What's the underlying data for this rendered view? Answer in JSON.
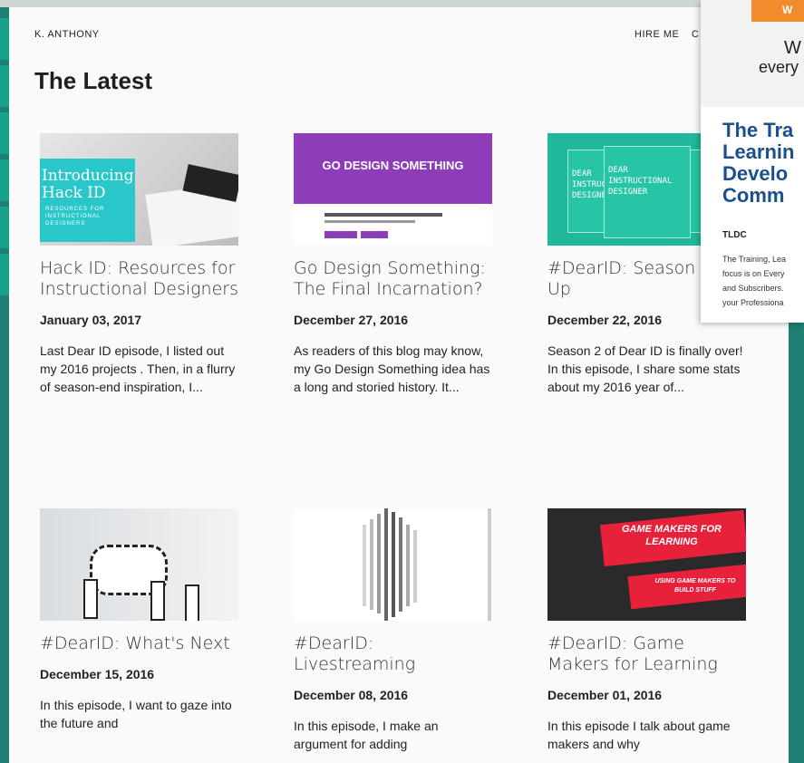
{
  "site": {
    "brand": "K. ANTHONY",
    "nav": [
      "HIRE ME",
      "C"
    ]
  },
  "section_title": "The Latest",
  "posts": [
    {
      "title": "Hack ID: Resources for Instructional Designers",
      "date": "January 03, 2017",
      "excerpt": "Last Dear ID episode, I listed out my 2016 projects . Then, in a flurry of season-end inspiration, I...",
      "thumb": {
        "big": "Introducing Hack ID",
        "small": "RESOURCES FOR INSTRUCTIONAL DESIGNERS"
      }
    },
    {
      "title": "Go Design Something: The Final Incarnation?",
      "date": "December 27, 2016",
      "excerpt": "As readers of this blog may know, my Go Design Something idea has a long and storied history. It...",
      "thumb": {
        "headline": "GO DESIGN SOMETHING",
        "accent": "#8e3db8"
      }
    },
    {
      "title": "#DearID: Season Wrap Up",
      "date": "December 22, 2016",
      "excerpt": "Season 2 of Dear ID is finally over! In this episode, I share some stats about my 2016 year of...",
      "thumb": {
        "text": "DEAR INSTRUCTIONAL DESIGNER"
      }
    },
    {
      "title": "#DearID: What's Next",
      "date": "December 15, 2016",
      "excerpt": "In this episode, I want to gaze into the future and",
      "thumb": {}
    },
    {
      "title": "#DearID: Livestreaming",
      "date": "December 08, 2016",
      "excerpt": "In this episode, I make an argument for adding",
      "thumb": {}
    },
    {
      "title": "#DearID: Game Makers for Learning",
      "date": "December 01, 2016",
      "excerpt": "In this episode I talk about game makers and why",
      "thumb": {
        "line1": "GAME MAKERS FOR LEARNING",
        "line2": "USING GAME MAKERS TO BUILD STUFF",
        "accent": "#e8213a"
      }
    }
  ],
  "ad": {
    "banner_letter": "W",
    "img_line1": "W",
    "img_line2": "every",
    "title_lines": [
      "The Tra",
      "Learnin",
      "Develo",
      "Comm"
    ],
    "byline": "TLDC",
    "desc_lines": [
      "The Training, Lea",
      "focus is on Every",
      "and Subscribers.",
      "your Professiona"
    ]
  },
  "colors": {
    "page_bg": "#fafafa",
    "teal_bg": "#1f7f72",
    "link_blue": "#1b4f8e"
  }
}
